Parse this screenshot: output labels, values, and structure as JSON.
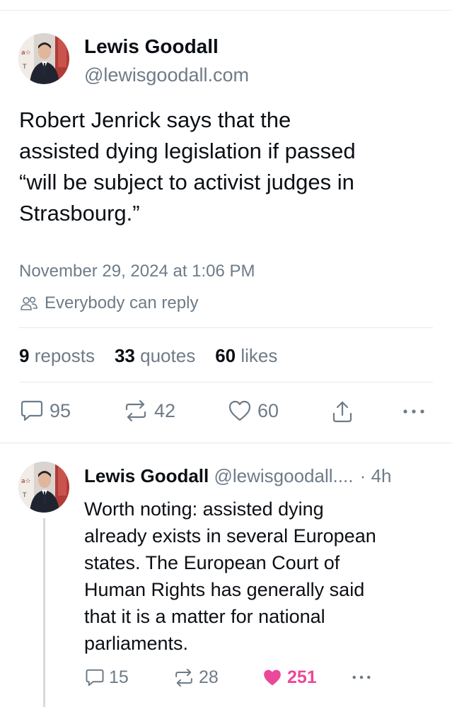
{
  "main_post": {
    "author_name": "Lewis Goodall",
    "handle": "@lewisgoodall.com",
    "text_lines": [
      "Robert Jenrick says that the",
      "assisted dying legislation if passed",
      "“will be subject to activist judges in",
      "Strasbourg.”"
    ],
    "timestamp": "November 29, 2024 at 1:06 PM",
    "reply_setting": "Everybody can reply",
    "stats": {
      "reposts_count": "9",
      "reposts_label": "reposts",
      "quotes_count": "33",
      "quotes_label": "quotes",
      "likes_count": "60",
      "likes_label": "likes"
    },
    "actions": {
      "replies": "95",
      "reposts": "42",
      "likes": "60"
    }
  },
  "reply_post": {
    "author_name": "Lewis Goodall",
    "handle": "@lewisgoodall....",
    "separator": "·",
    "time_ago": "4h",
    "text_lines": [
      "Worth noting: assisted dying",
      "already exists in several European",
      "states. The European Court of",
      "Human Rights has generally said",
      "that it is a matter for national",
      "parliaments."
    ],
    "actions": {
      "replies": "15",
      "reposts": "28",
      "likes": "251",
      "liked": true
    }
  },
  "icons": {
    "reply_setting": "people-icon",
    "reply": "speech-bubble-icon",
    "repost": "repost-icon",
    "like": "heart-icon",
    "share": "share-icon",
    "more": "more-icon"
  },
  "colors": {
    "text": "#0b0f14",
    "muted": "#6e7b88",
    "divider": "#e5e8eb",
    "like_active": "#ec4899",
    "thread_line": "#d6dade"
  }
}
